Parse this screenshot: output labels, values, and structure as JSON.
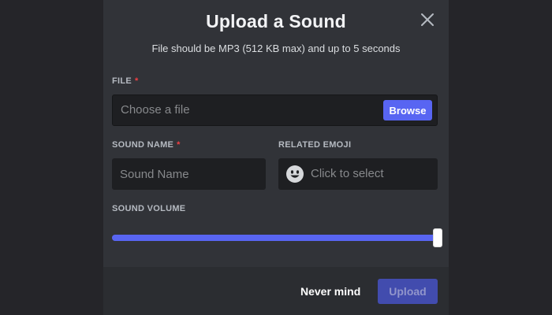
{
  "dialog": {
    "title": "Upload a Sound",
    "subtitle": "File should be MP3 (512 KB max) and up to 5 seconds"
  },
  "file": {
    "label": "FILE",
    "required_marker": "*",
    "placeholder": "Choose a file",
    "browse_label": "Browse"
  },
  "sound_name": {
    "label": "SOUND NAME",
    "required_marker": "*",
    "placeholder": "Sound Name",
    "value": ""
  },
  "related_emoji": {
    "label": "RELATED EMOJI",
    "placeholder": "Click to select",
    "icon": "smiley-face-icon"
  },
  "volume": {
    "label": "SOUND VOLUME",
    "value_percent": 100
  },
  "footer": {
    "cancel_label": "Never mind",
    "upload_label": "Upload",
    "upload_disabled": true
  },
  "colors": {
    "accent": "#5865f2",
    "required": "#f23f43",
    "modal_bg": "#313338",
    "input_bg": "#1e1f22",
    "page_bg": "#252529"
  }
}
